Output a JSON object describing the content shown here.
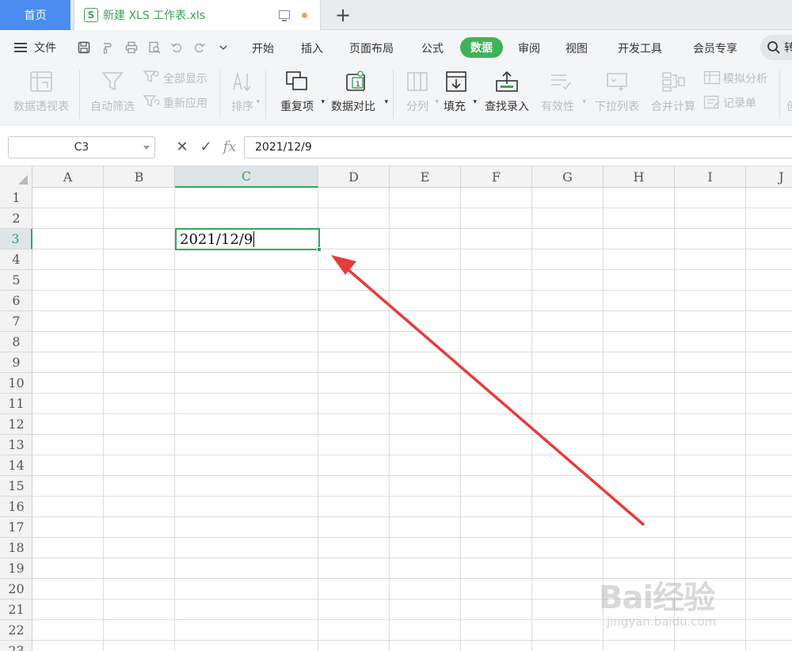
{
  "tabs": {
    "home": "首页",
    "doc_icon": "S",
    "doc_title": "新建 XLS 工作表.xls",
    "add": "+"
  },
  "menu": {
    "file": "文件",
    "items": [
      "开始",
      "插入",
      "页面布局",
      "公式",
      "数据",
      "审阅",
      "视图",
      "开发工具",
      "会员专享"
    ],
    "search_text": "转"
  },
  "ribbon": {
    "pivot": "数据透视表",
    "auto_filter": "自动筛选",
    "show_all": "全部显示",
    "reapply": "重新应用",
    "sort": "排序",
    "duplicates": "重复项",
    "compare": "数据对比",
    "split": "分列",
    "fill": "填充",
    "lookup": "查找录入",
    "validity": "有效性",
    "dropdown": "下拉列表",
    "consolidate": "合并计算",
    "whatif": "模拟分析",
    "record": "记录单",
    "cut_label": "创"
  },
  "formula_bar": {
    "name_box": "C3",
    "fx": "fx",
    "value": "2021/12/9"
  },
  "sheet": {
    "columns": [
      "A",
      "B",
      "C",
      "D",
      "E",
      "F",
      "G",
      "H",
      "I",
      "J"
    ],
    "rows": [
      "1",
      "2",
      "3",
      "4",
      "5",
      "6",
      "7",
      "8",
      "9",
      "10",
      "11",
      "12",
      "13",
      "14",
      "15",
      "16",
      "17",
      "18",
      "19",
      "20",
      "21",
      "22",
      "23"
    ],
    "active_column": "C",
    "active_row": "3",
    "active_cell_value": "2021/12/9"
  },
  "colors": {
    "accent_green": "#3aa35a",
    "home_tab_blue": "#4a8cf0",
    "annotation_red": "#e83b3b"
  },
  "watermark": {
    "brand": "Bai经验",
    "url": "jingyan.baidu.com"
  }
}
